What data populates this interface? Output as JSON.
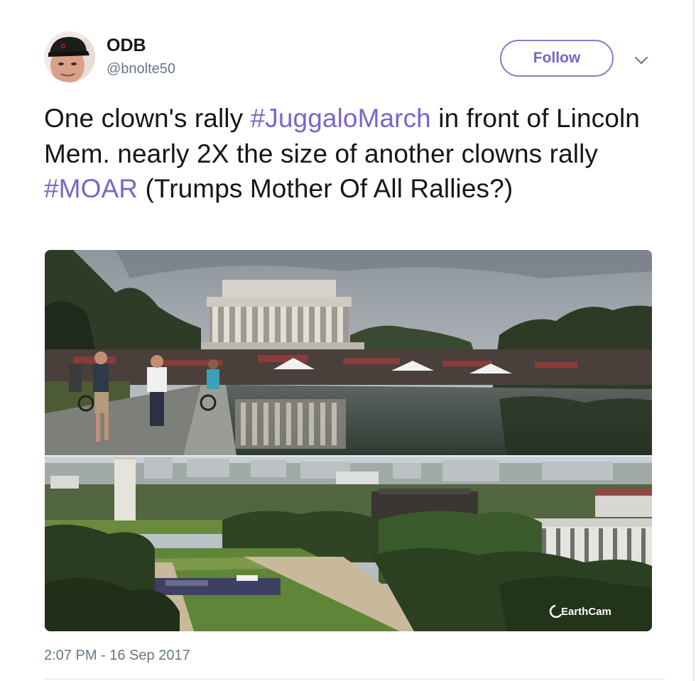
{
  "tweet": {
    "author": {
      "name": "ODB",
      "handle": "@bnolte50"
    },
    "follow_label": "Follow",
    "text_parts": [
      {
        "type": "text",
        "value": "One clown's rally "
      },
      {
        "type": "hashtag",
        "value": "#JuggaloMarch"
      },
      {
        "type": "text",
        "value": " in front of Lincoln Mem. nearly 2X the size of another clowns rally "
      },
      {
        "type": "hashtag",
        "value": "#MOAR"
      },
      {
        "type": "text",
        "value": " (Trumps Mother Of All Rallies?)"
      }
    ],
    "media": {
      "top_photo": "Lincoln Memorial with crowd beside reflecting pool",
      "bottom_photo": "Aerial view of National Mall with Washington Monument and small crowd",
      "watermark": "EarthCam"
    },
    "timestamp": "2:07 PM - 16 Sep 2017"
  },
  "colors": {
    "hashtag": "#7a66c8",
    "follow_border": "#8a79c8",
    "secondary_text": "#657786"
  },
  "icons": {
    "menu": "chevron-down-icon",
    "watermark": "earthcam-logo-icon"
  }
}
